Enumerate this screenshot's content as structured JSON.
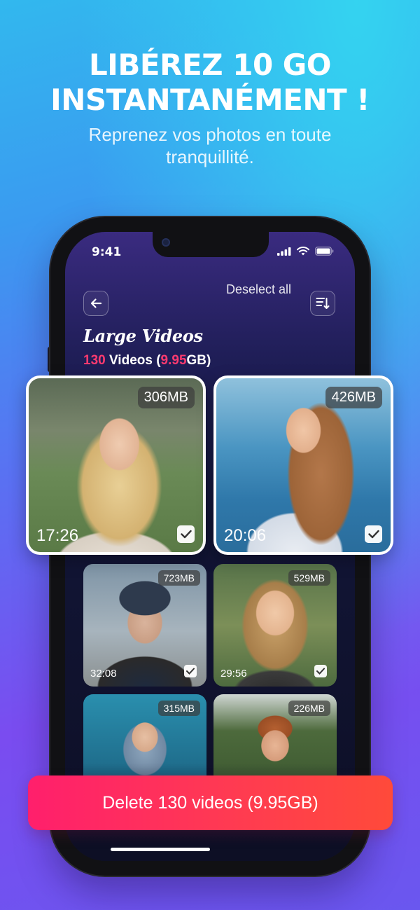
{
  "headline": {
    "line1": "LIBÉREZ 10 GO",
    "line2": "INSTANTANÉMENT !"
  },
  "subheadline": {
    "line1": "Reprenez vos photos en toute",
    "line2": "tranquillité."
  },
  "status_bar": {
    "time": "9:41"
  },
  "toolbar": {
    "deselect_label": "Deselect all",
    "back_icon": "arrow-left-icon",
    "sort_icon": "sort-icon"
  },
  "section": {
    "title": "Large Videos",
    "count": "130",
    "count_label": " Videos (",
    "size": "9.95",
    "size_suffix": "GB)"
  },
  "videos": [
    {
      "size": "306MB",
      "duration": "17:26",
      "selected": true
    },
    {
      "size": "426MB",
      "duration": "20:06",
      "selected": true
    },
    {
      "size": "723MB",
      "duration": "32:08",
      "selected": true
    },
    {
      "size": "529MB",
      "duration": "29:56",
      "selected": true
    },
    {
      "size": "315MB",
      "duration": "",
      "selected": false
    },
    {
      "size": "226MB",
      "duration": "",
      "selected": false
    }
  ],
  "cta": {
    "label": "Delete 130 videos (9.95GB)"
  },
  "colors": {
    "accent": "#ff3a6f",
    "cta_start": "#ff1f6c",
    "cta_end": "#ff4a3a"
  }
}
